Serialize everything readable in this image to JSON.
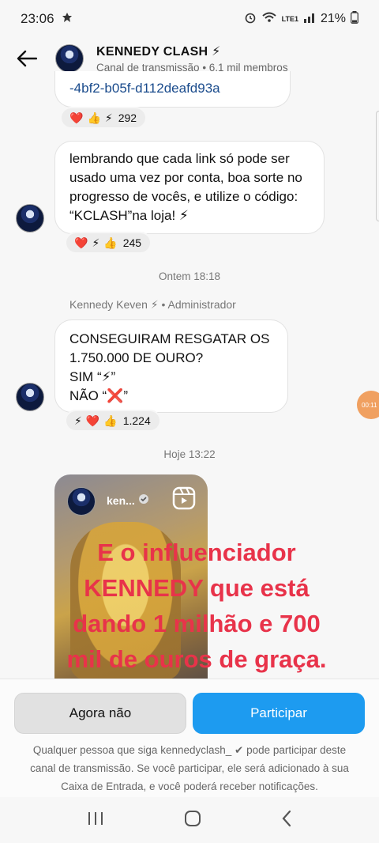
{
  "status_bar": {
    "time": "23:06",
    "battery": "21%",
    "network": "LTE1"
  },
  "header": {
    "title": "KENNEDY CLASH ⚡",
    "subtitle": "Canal de transmissão • 6,1 mil membros"
  },
  "messages": [
    {
      "text": "-4bf2-b05f-d112deafd93a",
      "reactions": [
        "❤️",
        "👍",
        "⚡"
      ],
      "count": "292"
    },
    {
      "text": "lembrando que cada link só pode ser usado uma vez por conta, boa sorte no progresso de vocês, e utilize o código: “KCLASH”na loja! ⚡",
      "reactions": [
        "❤️",
        "⚡",
        "👍"
      ],
      "count": "245"
    },
    {
      "timestamp": "Ontem 18:18",
      "author": "Kennedy Keven ⚡ • Administrador",
      "line1": "CONSEGUIRAM RESGATAR OS 1.750.000 DE OURO?",
      "line2": "SIM “⚡”",
      "line3": "NÃO “❌”",
      "reactions": [
        "⚡",
        "❤️",
        "👍"
      ],
      "count": "1.224"
    },
    {
      "timestamp": "Hoje 13:22",
      "media_author": "ken...",
      "overlay_text": "E o influenciador KENNEDY que está dando 1 milhão e 700 mil de ouros de graça."
    }
  ],
  "actions": {
    "decline_label": "Agora não",
    "join_label": "Participar"
  },
  "disclaimer": "Qualquer pessoa que siga kennedyclash_ ✔ pode participar deste canal de transmissão. Se você participar, ele será adicionado à sua Caixa de Entrada, e você poderá receber notificações.",
  "floating_bubble": "00:11",
  "colors": {
    "primary": "#1d9bf0",
    "overlay_red": "#e8334a",
    "secondary_btn": "#e1e1e1"
  }
}
